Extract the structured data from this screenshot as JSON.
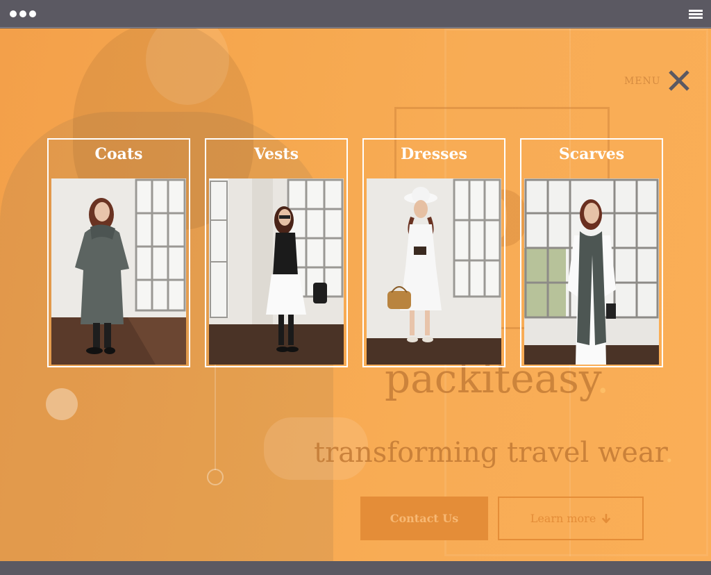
{
  "overlay": {
    "menu_label": "MENU",
    "categories": [
      {
        "label": "Coats"
      },
      {
        "label": "Vests"
      },
      {
        "label": "Dresses"
      },
      {
        "label": "Scarves"
      }
    ]
  },
  "background": {
    "brand": "packiteasy",
    "brand_dot": ".",
    "tagline": "transforming travel wear",
    "tagline_dot": ".",
    "contact_label": "Contact Us",
    "learn_label": "Learn more"
  },
  "colors": {
    "overlay": "#f7a64f",
    "chrome": "#5b5962",
    "accent": "#ffc36b",
    "close_icon": "#5b5962"
  },
  "icons": {
    "window_dots": "window-controls-icon",
    "hamburger": "hamburger-menu-icon",
    "close": "close-icon",
    "arrow": "arrow-down-icon"
  }
}
